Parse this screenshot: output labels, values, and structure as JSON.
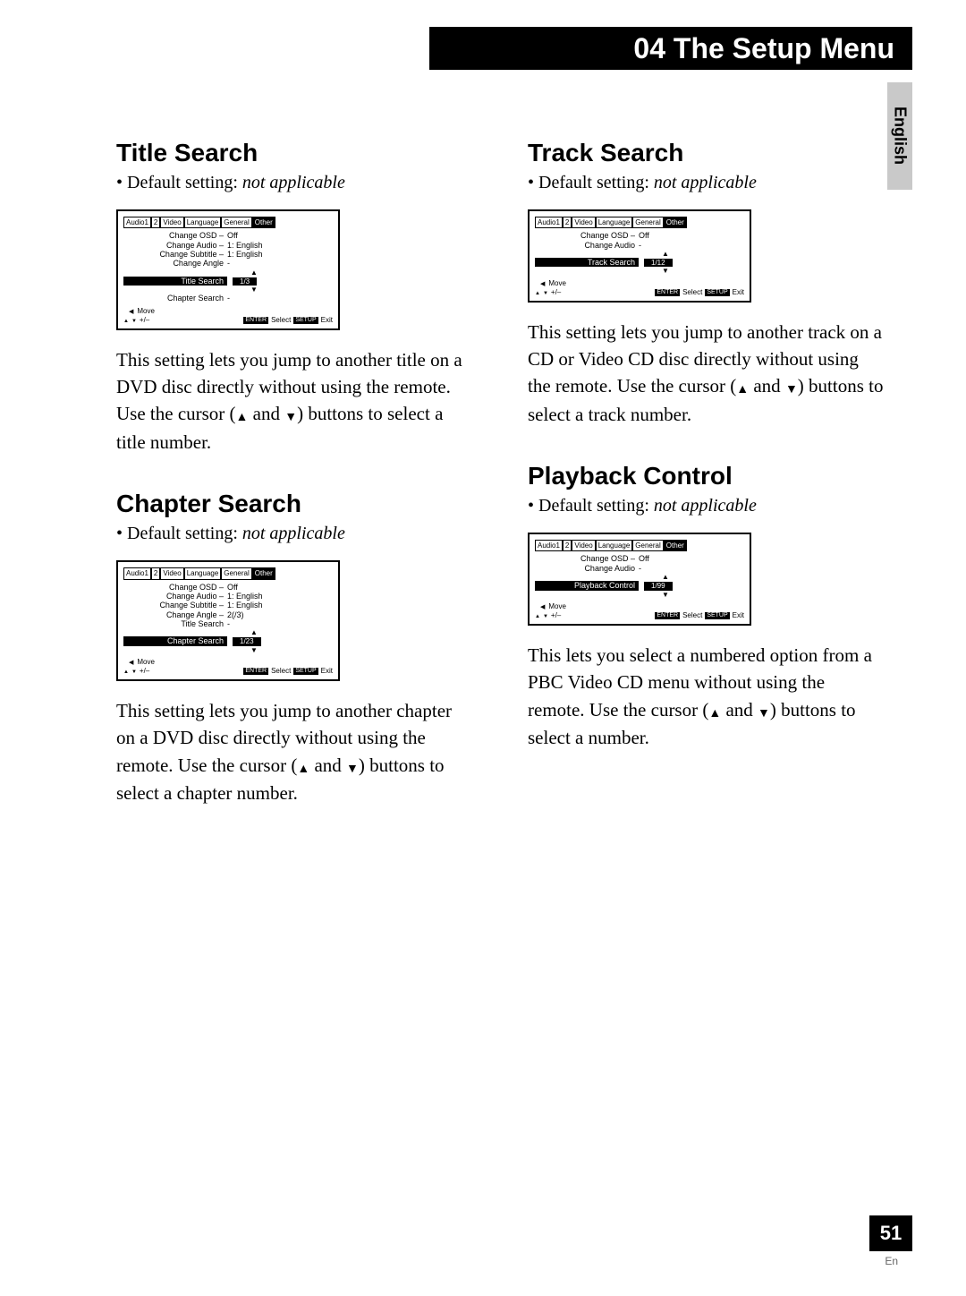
{
  "chapter": {
    "title": "04 The Setup Menu"
  },
  "sideTab": "English",
  "footer": {
    "page": "51",
    "lang": "En"
  },
  "default_label": "Default setting:",
  "default_value": "not applicable",
  "osd_common": {
    "tabs": [
      "Audio1",
      "2",
      "Video",
      "Language",
      "General",
      "Other"
    ],
    "footer": {
      "move": "Move",
      "plusminus": "+/–",
      "enter": "ENTER",
      "select": "Select",
      "setup": "SETUP",
      "exit": "Exit"
    }
  },
  "sections": {
    "title_search": {
      "heading": "Title Search",
      "osd": {
        "lines": [
          {
            "k": "Change OSD –",
            "v": "Off"
          },
          {
            "k": "Change Audio –",
            "v": "1: English"
          },
          {
            "k": "Change Subtitle –",
            "v": "1: English"
          },
          {
            "k": "Change Angle",
            "v": "-"
          },
          {
            "k": "Title Search",
            "v": "",
            "hi": true,
            "box": "1/3"
          },
          {
            "k": "Chapter Search",
            "v": "-"
          }
        ]
      },
      "body_pre": "This setting lets you jump to another title on a DVD disc directly without using the remote. Use the cursor (",
      "body_mid": " and ",
      "body_post": ") buttons to select a title number."
    },
    "chapter_search": {
      "heading": "Chapter Search",
      "osd": {
        "lines": [
          {
            "k": "Change OSD –",
            "v": "Off"
          },
          {
            "k": "Change Audio –",
            "v": "1: English"
          },
          {
            "k": "Change Subtitle –",
            "v": "1: English"
          },
          {
            "k": "Change Angle –",
            "v": "2(/3)"
          },
          {
            "k": "Title Search",
            "v": "-"
          },
          {
            "k": "Chapter Search",
            "v": "",
            "hi": true,
            "box": "1/23"
          }
        ]
      },
      "body_pre": "This setting lets you jump to another chapter on a DVD disc directly without using the remote. Use the cursor (",
      "body_mid": " and ",
      "body_post": ") buttons to select a chapter number."
    },
    "track_search": {
      "heading": "Track Search",
      "osd": {
        "lines": [
          {
            "k": "Change OSD –",
            "v": "Off"
          },
          {
            "k": "Change Audio",
            "v": "-"
          },
          {
            "k": "Track Search",
            "v": "",
            "hi": true,
            "box": "1/12"
          }
        ]
      },
      "body_pre": "This setting lets you jump to another track on a CD or Video CD disc directly without using the remote. Use the cursor (",
      "body_mid": " and ",
      "body_post": ") buttons to select a track number."
    },
    "playback_control": {
      "heading": "Playback Control",
      "osd": {
        "lines": [
          {
            "k": "Change OSD –",
            "v": "Off"
          },
          {
            "k": "Change Audio",
            "v": "-"
          },
          {
            "k": "Playback Control",
            "v": "",
            "hi": true,
            "box": "1/99"
          }
        ]
      },
      "body_pre": "This lets you select a numbered option from a PBC Video CD menu without using the remote. Use the cursor (",
      "body_mid": " and ",
      "body_post": ") buttons to select a number."
    }
  }
}
